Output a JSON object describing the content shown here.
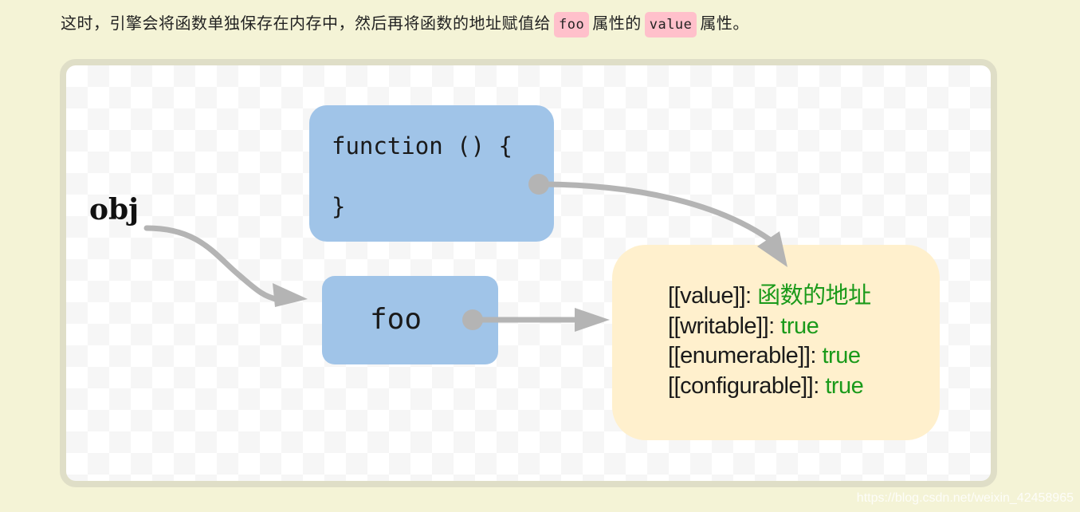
{
  "paragraph": {
    "text_before": "这时，引擎会将函数单独保存在内存中，然后再将函数的地址赋值给",
    "chip1": "foo",
    "text_middle": "属性的",
    "chip2": "value",
    "text_after": "属性。"
  },
  "diagram": {
    "obj_label": "obj",
    "function_box": {
      "line1": "function () {",
      "line2": "}"
    },
    "foo_box": {
      "label": "foo"
    },
    "property_box": {
      "rows": [
        {
          "key": "[[value]]: ",
          "value": "函数的地址"
        },
        {
          "key": "[[writable]]: ",
          "value": "true"
        },
        {
          "key": "[[enumerable]]: ",
          "value": "true"
        },
        {
          "key": "[[configurable]]: ",
          "value": "true"
        }
      ]
    },
    "edges": [
      {
        "from": "obj",
        "to": "foo"
      },
      {
        "from": "foo",
        "to": "property_box"
      },
      {
        "from": "function_box",
        "to": "property_box"
      }
    ],
    "colors": {
      "node_blue": "#a0c4e8",
      "node_yellow": "#fff0cd",
      "arrow_gray": "#b4b4b4",
      "value_green": "#1a9a1a",
      "chip_pink": "#ffc0cb"
    }
  },
  "watermark": "https://blog.csdn.net/weixin_42458965"
}
